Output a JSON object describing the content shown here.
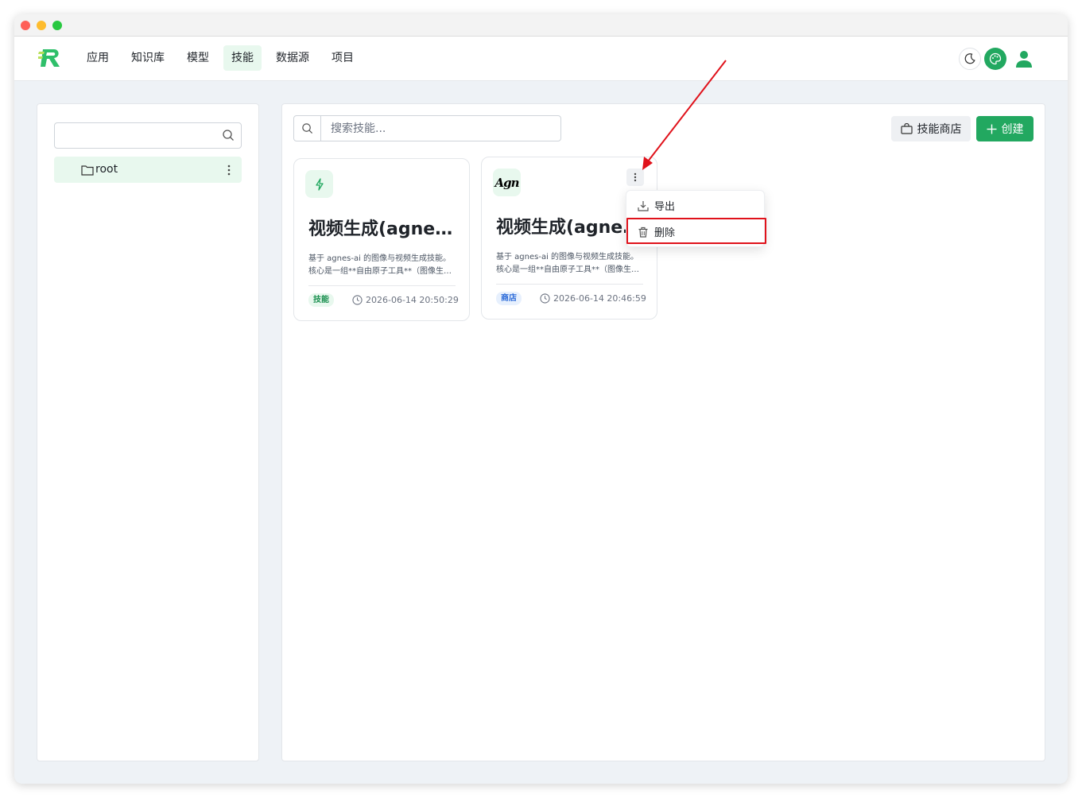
{
  "nav": {
    "items": [
      {
        "label": "应用"
      },
      {
        "label": "知识库"
      },
      {
        "label": "模型"
      },
      {
        "label": "技能"
      },
      {
        "label": "数据源"
      },
      {
        "label": "项目"
      }
    ],
    "active_index": 3,
    "icons": {
      "logo": "app-logo",
      "theme": "moon-icon",
      "palette": "palette-icon",
      "user": "user-icon"
    }
  },
  "sidebar": {
    "search_placeholder": "",
    "tree": [
      {
        "label": "root"
      }
    ]
  },
  "main": {
    "search_placeholder": "搜索技能...",
    "store_label": "技能商店",
    "create_label": "创建",
    "cards": [
      {
        "title": "视频生成(agnes-ai)",
        "description": "基于 agnes-ai 的图像与视频生成技能。核心是一组**自由原子工具**（图像生成、视频生成等）",
        "tag": "技能",
        "time": "2026-06-14 20:50:29"
      },
      {
        "title": "视频生成(agnes-ai)",
        "description": "基于 agnes-ai 的图像与视频生成技能。核心是一组**自由原子工具**（图像生成、视频生成等）",
        "tag": "商店",
        "time": "2026-06-14 20:46:59",
        "avatar_text": "Agn"
      }
    ],
    "menu": [
      {
        "label": "导出"
      },
      {
        "label": "删除"
      }
    ]
  },
  "colors": {
    "accent": "#22a860",
    "highlight": "#e0121b",
    "tag_blue": "#2b6ad8"
  }
}
